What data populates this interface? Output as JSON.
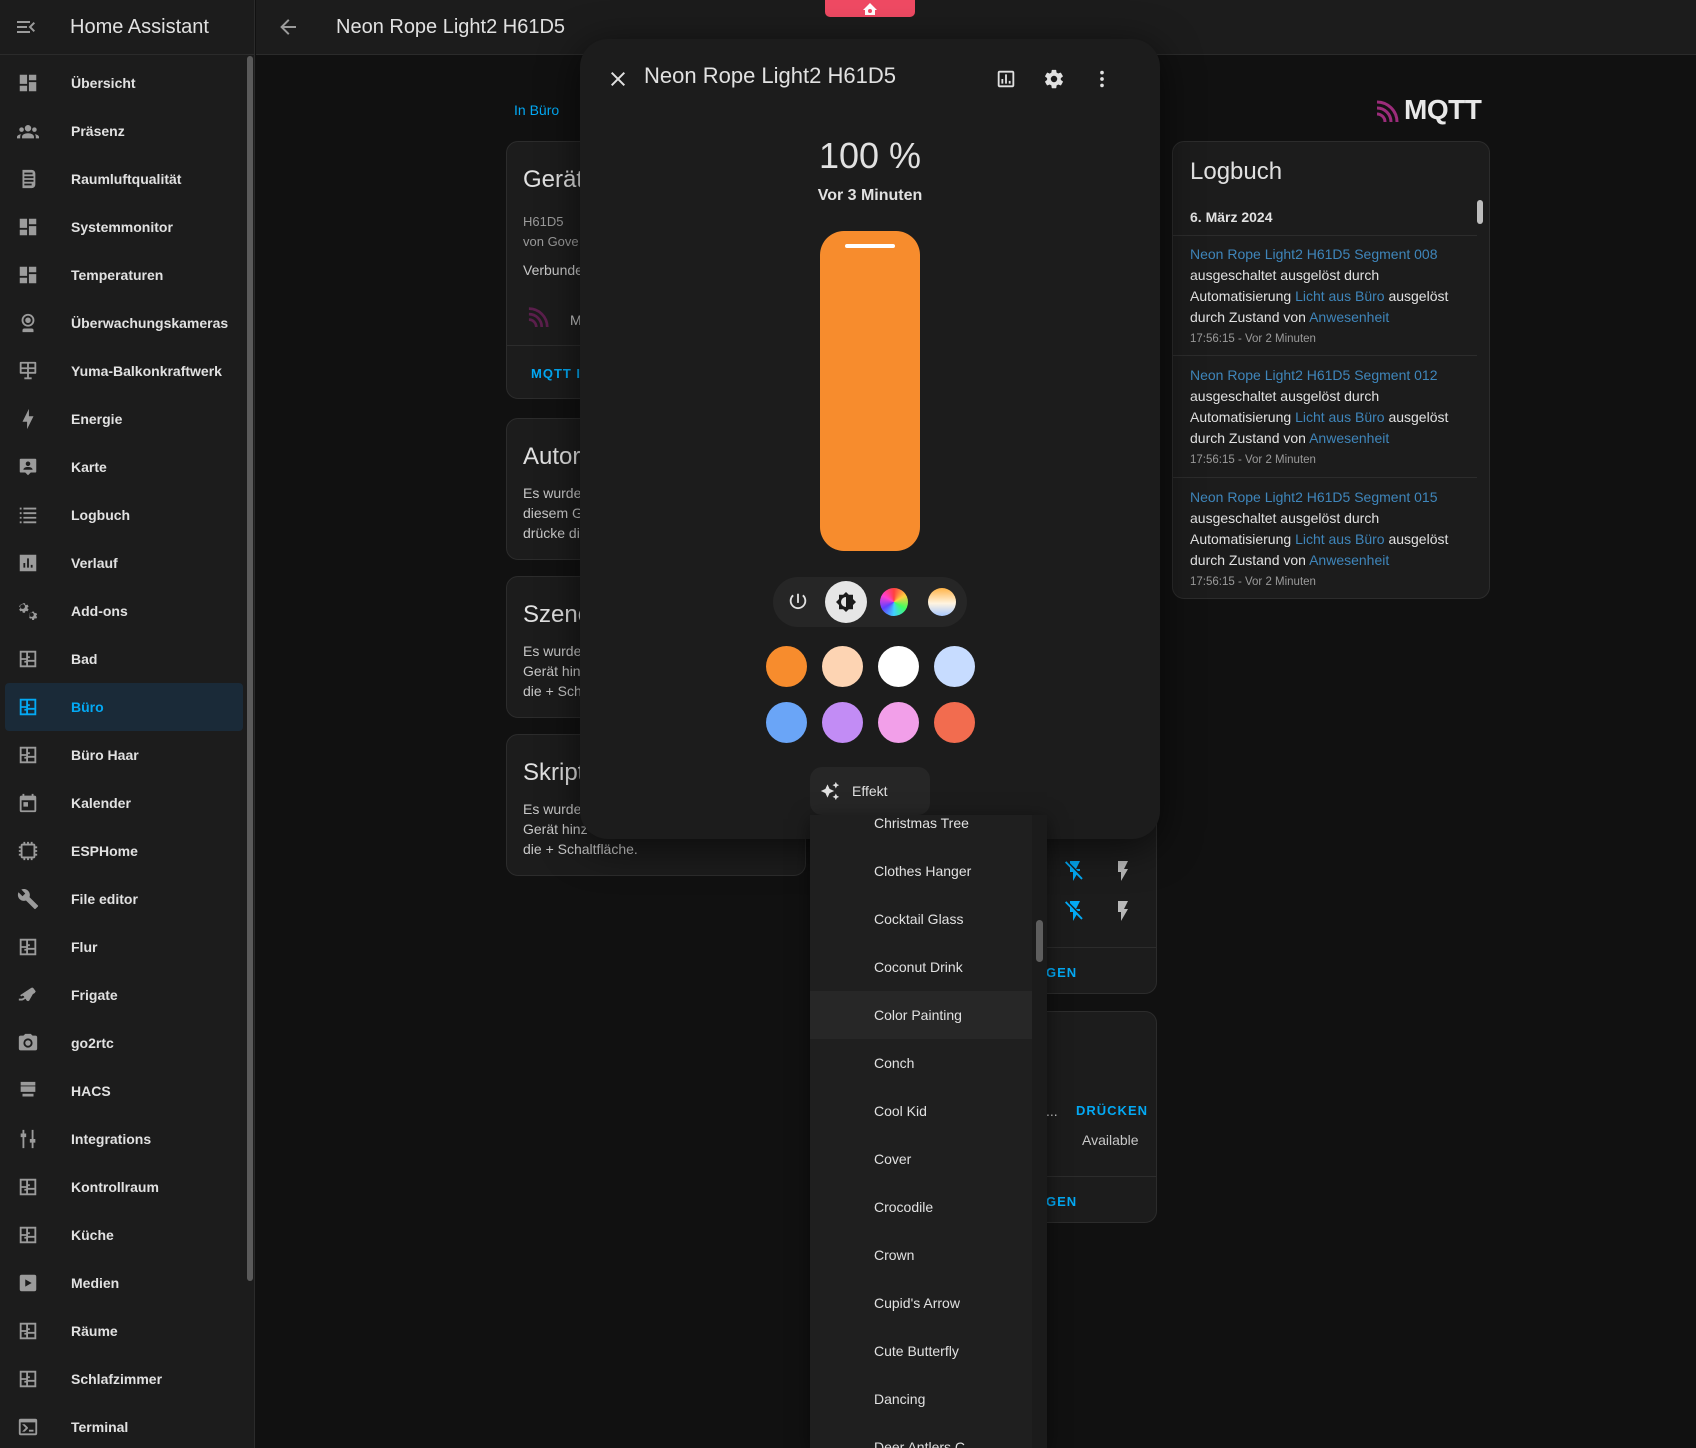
{
  "app": {
    "title": "Home Assistant"
  },
  "topbar": {
    "title": "Neon Rope Light2 H61D5"
  },
  "sidebar": {
    "items": [
      {
        "label": "Übersicht",
        "icon": "dashboard-icon"
      },
      {
        "label": "Präsenz",
        "icon": "people-icon"
      },
      {
        "label": "Raumluftqualität",
        "icon": "air-icon"
      },
      {
        "label": "Systemmonitor",
        "icon": "dashboard-icon"
      },
      {
        "label": "Temperaturen",
        "icon": "dashboard-icon"
      },
      {
        "label": "Überwachungskameras",
        "icon": "webcam-icon"
      },
      {
        "label": "Yuma-Balkonkraftwerk",
        "icon": "solar-panel-icon"
      },
      {
        "label": "Energie",
        "icon": "lightning-icon"
      },
      {
        "label": "Karte",
        "icon": "map-icon"
      },
      {
        "label": "Logbuch",
        "icon": "list-icon"
      },
      {
        "label": "Verlauf",
        "icon": "chart-icon"
      },
      {
        "label": "Add-ons",
        "icon": "cogs-icon"
      },
      {
        "label": "Bad",
        "icon": "floorplan-icon"
      },
      {
        "label": "Büro",
        "icon": "floorplan-icon",
        "active": true
      },
      {
        "label": "Büro Haar",
        "icon": "floorplan-icon"
      },
      {
        "label": "Kalender",
        "icon": "calendar-icon"
      },
      {
        "label": "ESPHome",
        "icon": "chip-icon"
      },
      {
        "label": "File editor",
        "icon": "wrench-icon"
      },
      {
        "label": "Flur",
        "icon": "floorplan-icon"
      },
      {
        "label": "Frigate",
        "icon": "cctv-icon"
      },
      {
        "label": "go2rtc",
        "icon": "camera-icon"
      },
      {
        "label": "HACS",
        "icon": "hacs-icon"
      },
      {
        "label": "Integrations",
        "icon": "tune-icon"
      },
      {
        "label": "Kontrollraum",
        "icon": "floorplan-icon"
      },
      {
        "label": "Küche",
        "icon": "floorplan-icon"
      },
      {
        "label": "Medien",
        "icon": "play-box-icon"
      },
      {
        "label": "Räume",
        "icon": "floorplan-icon"
      },
      {
        "label": "Schlafzimmer",
        "icon": "floorplan-icon"
      },
      {
        "label": "Terminal",
        "icon": "console-icon"
      }
    ]
  },
  "page": {
    "breadcrumb": "In Büro",
    "mqtt_logo": "MQTT",
    "device_card": {
      "title": "Gerät",
      "model": "H61D5",
      "manufacturer": "von Gove",
      "connected": "Verbunde",
      "integration_initial": "M",
      "link": "MQTT IN"
    },
    "automation_card": {
      "title": "Autor",
      "lines": [
        "Es wurde",
        "diesem G",
        "drücke di"
      ]
    },
    "scenes_card": {
      "title": "Szene",
      "lines": [
        "Es wurde",
        "Gerät hin",
        "die + Sch"
      ]
    },
    "scripts_card": {
      "title": "Skript",
      "lines": [
        "Es wurde",
        "Gerät hinz",
        "die + Schaltfläche."
      ]
    },
    "controls_card": {
      "link": "GEN"
    },
    "diag_card": {
      "ellipsis": "...",
      "press": "DRÜCKEN",
      "status": "Available",
      "link": "GEN"
    }
  },
  "logbook": {
    "title": "Logbuch",
    "date": "6. März 2024",
    "entries": [
      {
        "entity": "Neon Rope Light2 H61D5 Segment 008",
        "action": "ausgeschaltet ausgelöst durch",
        "via": "Automatisierung",
        "automation": "Licht aus Büro",
        "trigger": "ausgelöst",
        "by": "durch Zustand von",
        "source": "Anwesenheit",
        "time": "17:56:15 - Vor 2 Minuten"
      },
      {
        "entity": "Neon Rope Light2 H61D5 Segment 012",
        "action": "ausgeschaltet ausgelöst durch",
        "via": "Automatisierung",
        "automation": "Licht aus Büro",
        "trigger": "ausgelöst",
        "by": "durch Zustand von",
        "source": "Anwesenheit",
        "time": "17:56:15 - Vor 2 Minuten"
      },
      {
        "entity": "Neon Rope Light2 H61D5 Segment 015",
        "action": "ausgeschaltet ausgelöst durch",
        "via": "Automatisierung",
        "automation": "Licht aus Büro",
        "trigger": "ausgelöst",
        "by": "durch Zustand von",
        "source": "Anwesenheit",
        "time": "17:56:15 - Vor 2 Minuten"
      }
    ]
  },
  "dialog": {
    "title": "Neon Rope Light2 H61D5",
    "state": "100 %",
    "last_changed": "Vor 3 Minuten",
    "brightness_fraction": 1.0,
    "slider_color": "#f78c2d",
    "modes": [
      "power-icon",
      "brightness-icon",
      "color-wheel-icon",
      "color-temp-icon"
    ],
    "selected_mode": "brightness-icon",
    "swatches": [
      "#f78c2d",
      "#fdd4b3",
      "#ffffff",
      "#c7dcff",
      "#6aa5f7",
      "#c28cf5",
      "#f29fe9",
      "#f26c4f"
    ],
    "effect_label": "Effekt"
  },
  "effect_menu": {
    "items": [
      "Christmas Tree",
      "Clothes Hanger",
      "Cocktail Glass",
      "Coconut Drink",
      "Color Painting",
      "Conch",
      "Cool Kid",
      "Cover",
      "Crocodile",
      "Crown",
      "Cupid's Arrow",
      "Cute Butterfly",
      "Dancing",
      "Deer Antlers C"
    ],
    "highlighted": "Color Painting"
  },
  "colors": {
    "accent": "#03a9f4",
    "link": "#3f86bb",
    "badge": "#ef4a63"
  }
}
